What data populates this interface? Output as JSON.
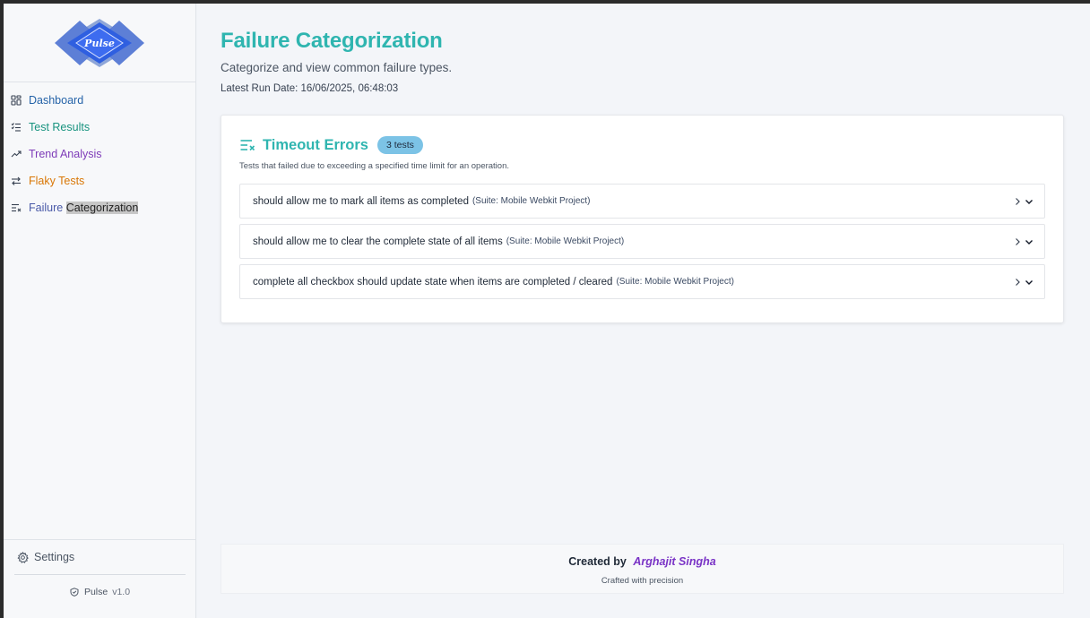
{
  "sidebar": {
    "logo_text": "Pulse",
    "items": [
      {
        "label": "Dashboard",
        "icon": "grid-icon",
        "color": "#2563a8"
      },
      {
        "label": "Test Results",
        "icon": "list-check-icon",
        "color": "#18937f"
      },
      {
        "label": "Trend Analysis",
        "icon": "trend-up-icon",
        "color": "#7e3bb8"
      },
      {
        "label": "Flaky Tests",
        "icon": "repeat-arrows-icon",
        "color": "#d97706"
      },
      {
        "label_prefix": "Failure",
        "label_highlight": "Categorization",
        "icon": "list-x-icon",
        "color": "#4a5aa8"
      }
    ],
    "settings_label": "Settings",
    "app_name": "Pulse",
    "version": "v1.0"
  },
  "main": {
    "title": "Failure Categorization",
    "subtitle": "Categorize and view common failure types.",
    "run_date": "Latest Run Date: 16/06/2025, 06:48:03",
    "category": {
      "title": "Timeout Errors",
      "badge": "3 tests",
      "description": "Tests that failed due to exceeding a specified time limit for an operation.",
      "tests": [
        {
          "name": "should allow me to mark all items as completed",
          "suite": "(Suite: Mobile Webkit Project)"
        },
        {
          "name": "should allow me to clear the complete state of all items",
          "suite": "(Suite: Mobile Webkit Project)"
        },
        {
          "name": "complete all checkbox should update state when items are completed / cleared",
          "suite": "(Suite: Mobile Webkit Project)"
        }
      ]
    }
  },
  "footer": {
    "created_by": "Created by",
    "author": "Arghajit Singha",
    "tagline": "Crafted with precision"
  },
  "colors": {
    "accent": "#2fb5b0",
    "badge": "#7cc3e6",
    "author": "#7a33c6"
  }
}
